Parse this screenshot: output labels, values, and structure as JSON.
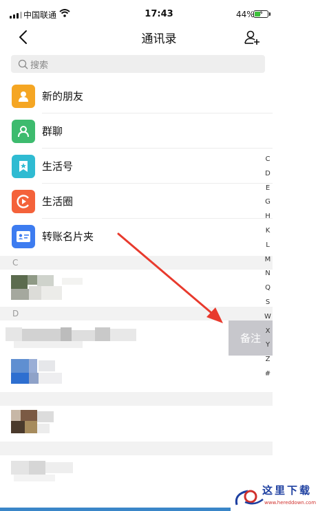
{
  "status_bar": {
    "carrier": "中国联通",
    "time": "17:43",
    "battery": "44%",
    "battery_level": 0.44
  },
  "nav": {
    "title": "通讯录",
    "back_icon": "chevron-left-icon",
    "add_icon": "add-contact-icon"
  },
  "search": {
    "placeholder": "搜索"
  },
  "functions": [
    {
      "label": "新的朋友",
      "icon": "person-icon",
      "color": "#f5a623"
    },
    {
      "label": "群聊",
      "icon": "group-icon",
      "color": "#3dbb6e"
    },
    {
      "label": "生活号",
      "icon": "bookmark-star-icon",
      "color": "#2fbbd2"
    },
    {
      "label": "生活圈",
      "icon": "circle-play-icon",
      "color": "#f4623a"
    },
    {
      "label": "转账名片夹",
      "icon": "card-icon",
      "color": "#3d7cf0"
    }
  ],
  "sections": [
    "C",
    "D"
  ],
  "index_letters": [
    "C",
    "D",
    "E",
    "G",
    "H",
    "K",
    "L",
    "M",
    "N",
    "Q",
    "S",
    "W",
    "X",
    "Y",
    "Z",
    "#"
  ],
  "swipe_action": {
    "label": "备注"
  },
  "watermark": {
    "text": "这里下载",
    "url": "www.hereddown.com"
  }
}
